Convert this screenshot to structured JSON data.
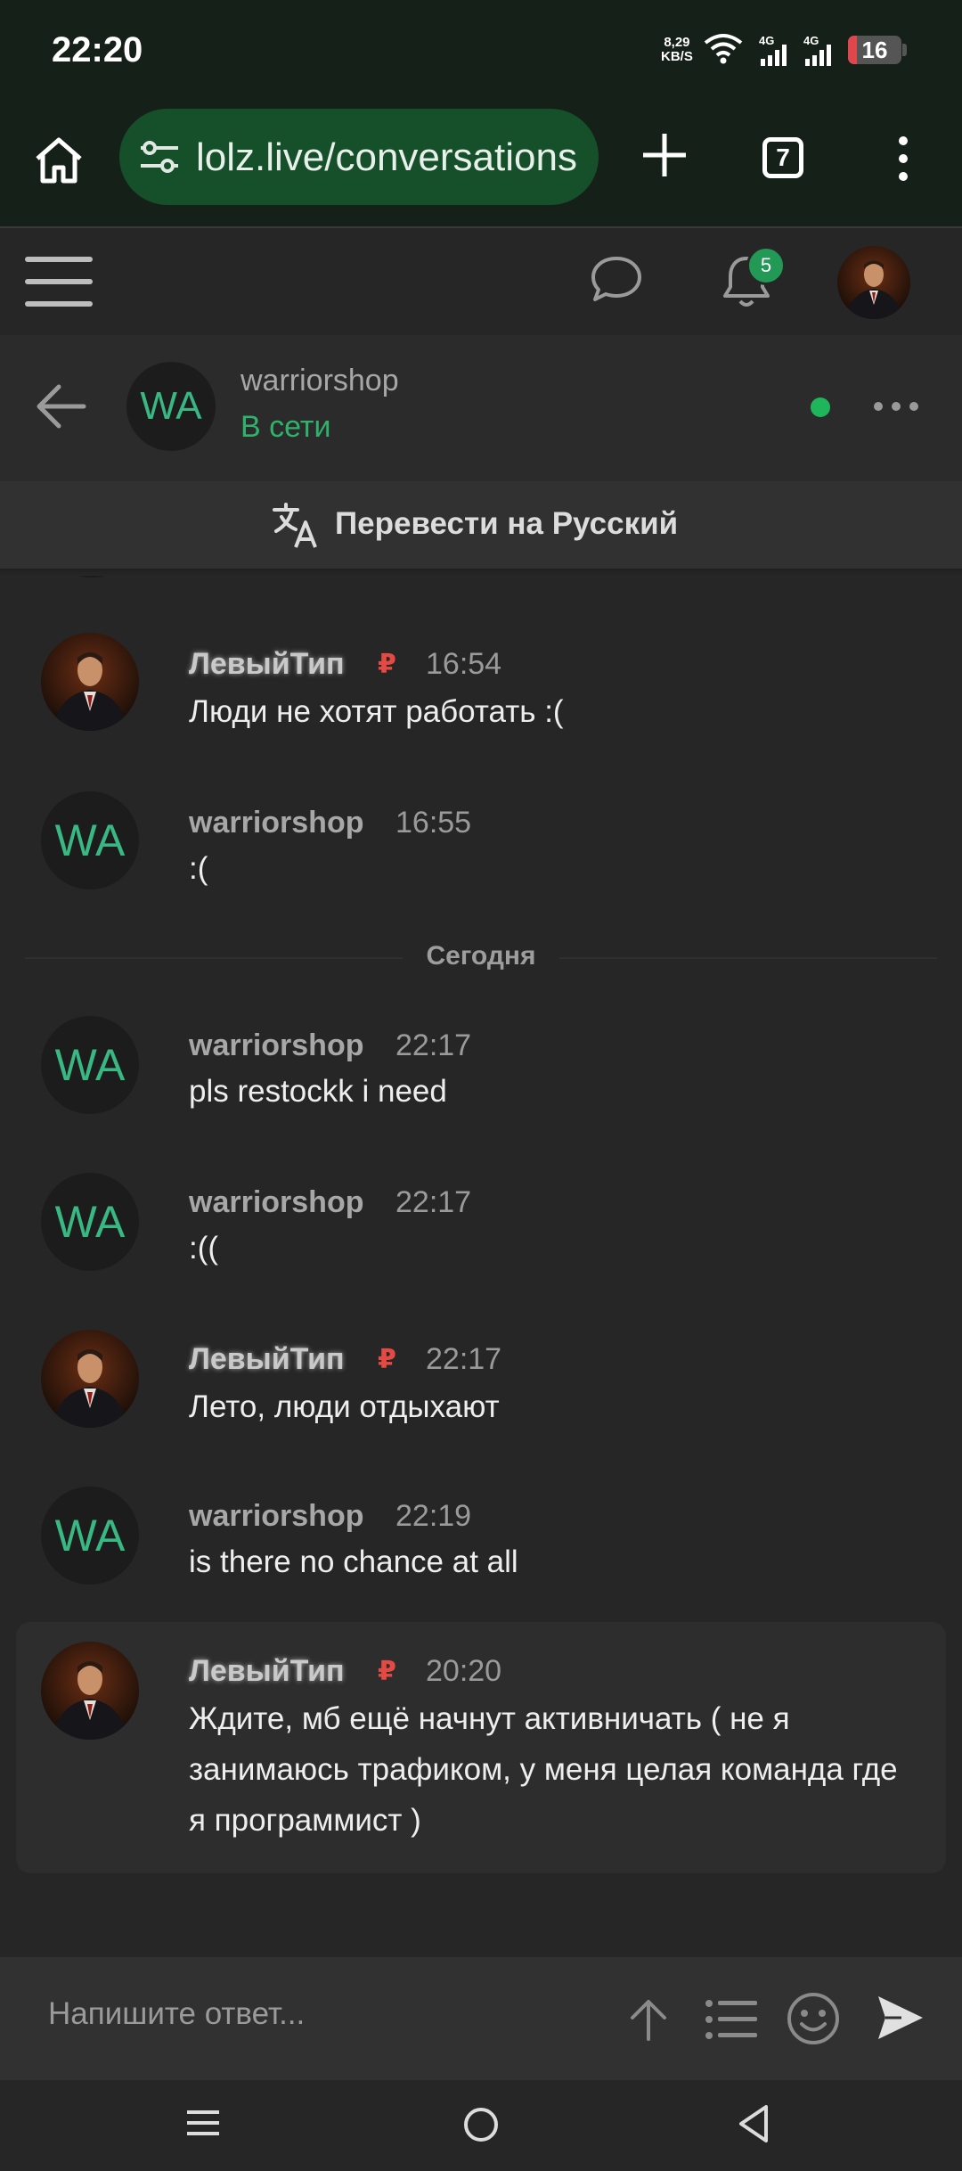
{
  "status_bar": {
    "time": "22:20",
    "speed_value": "8,29",
    "speed_unit": "KB/S",
    "net1": "4G",
    "net2": "4G",
    "battery": "16",
    "battery_fraction": 0.16
  },
  "browser": {
    "url": "lolz.live/conversations",
    "tab_count": "7"
  },
  "site_header": {
    "notification_count": "5"
  },
  "conversation": {
    "avatar_initials": "WA",
    "name": "warriorshop",
    "status": "В сети"
  },
  "translate_label": "Перевести на Русский",
  "day_separator": "Сегодня",
  "messages": [
    {
      "author": "ЛевыйТип",
      "badge": "₽",
      "time": "16:54",
      "text": "Люди не хотят работать :("
    },
    {
      "author": "warriorshop",
      "avatar": "WA",
      "time": "16:55",
      "text": ":("
    },
    {
      "author": "warriorshop",
      "avatar": "WA",
      "time": "22:17",
      "text": "pls restockk i need"
    },
    {
      "author": "warriorshop",
      "avatar": "WA",
      "time": "22:17",
      "text": ":(("
    },
    {
      "author": "ЛевыйТип",
      "badge": "₽",
      "time": "22:17",
      "text": "Лето, люди отдыхают"
    },
    {
      "author": "warriorshop",
      "avatar": "WA",
      "time": "22:19",
      "text": "is there no chance at all"
    },
    {
      "author": "ЛевыйТип",
      "badge": "₽",
      "time": "20:20",
      "text": "Ждите, мб ещё начнут активничать ( не я занимаюсь трафиком, у меня целая команда где я программист )"
    }
  ],
  "reply": {
    "placeholder": "Напишите ответ..."
  },
  "colors": {
    "accent_green": "#2fb36c",
    "rub_badge": "#e44a43",
    "notification_badge": "#229955",
    "background": "#262626"
  }
}
